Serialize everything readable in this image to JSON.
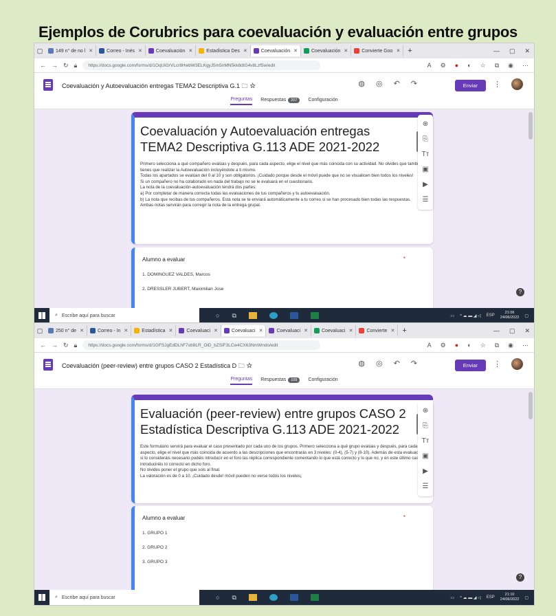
{
  "page_title": "Ejemplos de Corubrics para coevaluación y evaluación entre grupos",
  "colors": {
    "accent": "#673ab7",
    "blue_border": "#4285f4",
    "background": "#dcebc6"
  },
  "screenshots": [
    {
      "tabs": [
        {
          "label": "149 n° de no l",
          "color": "#5b79b4"
        },
        {
          "label": "Correo - Inés",
          "color": "#2b579a"
        },
        {
          "label": "Coevaluación",
          "color": "#673ab7"
        },
        {
          "label": "Estadística Des",
          "color": "#f4b400"
        },
        {
          "label": "Coevaluación",
          "color": "#673ab7",
          "active": true
        },
        {
          "label": "Coevaluación",
          "color": "#0f9d58"
        },
        {
          "label": "Convierte Goo",
          "color": "#ea4335"
        }
      ],
      "url": "https://docs.google.com/forms/d/1OqUiGrVLcr8HwbW3ELKgyJ5m5nMN5kk8dtG4v8Lzf5w/edit",
      "doc_title": "Coevaluación y Autoevaluación entregas TEMA2 Descriptiva G.1",
      "send_label": "Enviar",
      "nav_tabs": {
        "questions": "Preguntas",
        "responses": "Respuestas",
        "responses_count": "207",
        "settings": "Configuración"
      },
      "form_title": "Coevaluación y Autoevaluación entregas TEMA2 Descriptiva G.113 ADE 2021-2022",
      "form_description": "Primero selecciona a qué compañero evalúas y después, para cada aspecto, elige el nivel que más coincida con su actividad. No olvides que también tienes que realizar la Autoevaluación incluyéndote a ti mismo.\nTodas los apartados se evalúan del 0 al 10 y son obligatorios. ¡Cuidado porque desde el móvil puede que no se visualicen bien todos los niveles!\nSi un compañero no ha colaborado en nada del trabajo no se le evaluará en el cuestionario.\nLa nota de la coevaluación-autoevaluación tendrá dos partes:\na) Por completar de manera correcta todas las evaluaciones de tus compañeros y tu autoevaluación.\nb) La nota que recibas de tus compañeros. Esta nota se te enviará automáticamente a tu correo si se han procesado bien todas las respuestas.\nAmbas notas servirán para corregir la nota de la entrega grupal.",
      "question_title": "Alumno a evaluar",
      "options": [
        "1.  DOMINGUEZ VALDES, Marcos",
        "2.  DRESSLER JUBERT, Maximilian Jose"
      ],
      "taskbar_search": "Escribe aquí para buscar",
      "clock_time": "21:06",
      "clock_date": "24/06/2022"
    },
    {
      "tabs": [
        {
          "label": "250 n° de",
          "color": "#5b79b4"
        },
        {
          "label": "Correo - In",
          "color": "#2b579a"
        },
        {
          "label": "Estadística",
          "color": "#f4b400"
        },
        {
          "label": "Coevaluaci",
          "color": "#673ab7"
        },
        {
          "label": "Coevaluaci",
          "color": "#673ab7",
          "active": true
        },
        {
          "label": "Coevaluaci",
          "color": "#673ab7"
        },
        {
          "label": "Coevaluaci",
          "color": "#0f9d58"
        },
        {
          "label": "Convierte",
          "color": "#ea4335"
        }
      ],
      "url": "https://docs.google.com/forms/d/1GFSJgEdDLhF7ob9LR_OiD_bZSiF3LCw4CX63NmWndo/edit",
      "doc_title": "Coevaluación (peer-review) entre grupos CASO 2 Estadística D",
      "send_label": "Enviar",
      "nav_tabs": {
        "questions": "Preguntas",
        "responses": "Respuestas",
        "responses_count": "109",
        "settings": "Configuración"
      },
      "form_title": "Evaluación (peer-review) entre grupos CASO 2 Estadística Descriptiva G.113 ADE 2021-2022",
      "form_description": "Este formulario servirá para evaluar el caso presentado por cada uno de los grupos. Primero selecciona a qué grupo evalúas y después, para cada aspecto, elige el nivel que más coincida de acuerdo a las descripciones que encontrarás en 3 niveles: (0-4), (5-7) y (8-10).  Además de esta evaluación si lo consideráis necesario podéis introducir en el foro las réplica correspondiente comentando lo que está correcto y lo que no, y en este último caso introduciréis lo correcto en dicho foro.\nNo olvides poner el grupo que sois al final.\nLa valoración es de 0 a 10. ¡Cuidado desde! móvil pueden no verse todos los niveles¡",
      "question_title": "Alumno a evaluar",
      "options": [
        "1.  GRUPO 1",
        "2.  GRUPO 2",
        "3.  GRUPO 3"
      ],
      "taskbar_search": "Escribe aquí para buscar",
      "clock_time": "21:10",
      "clock_date": "24/06/2022"
    }
  ]
}
